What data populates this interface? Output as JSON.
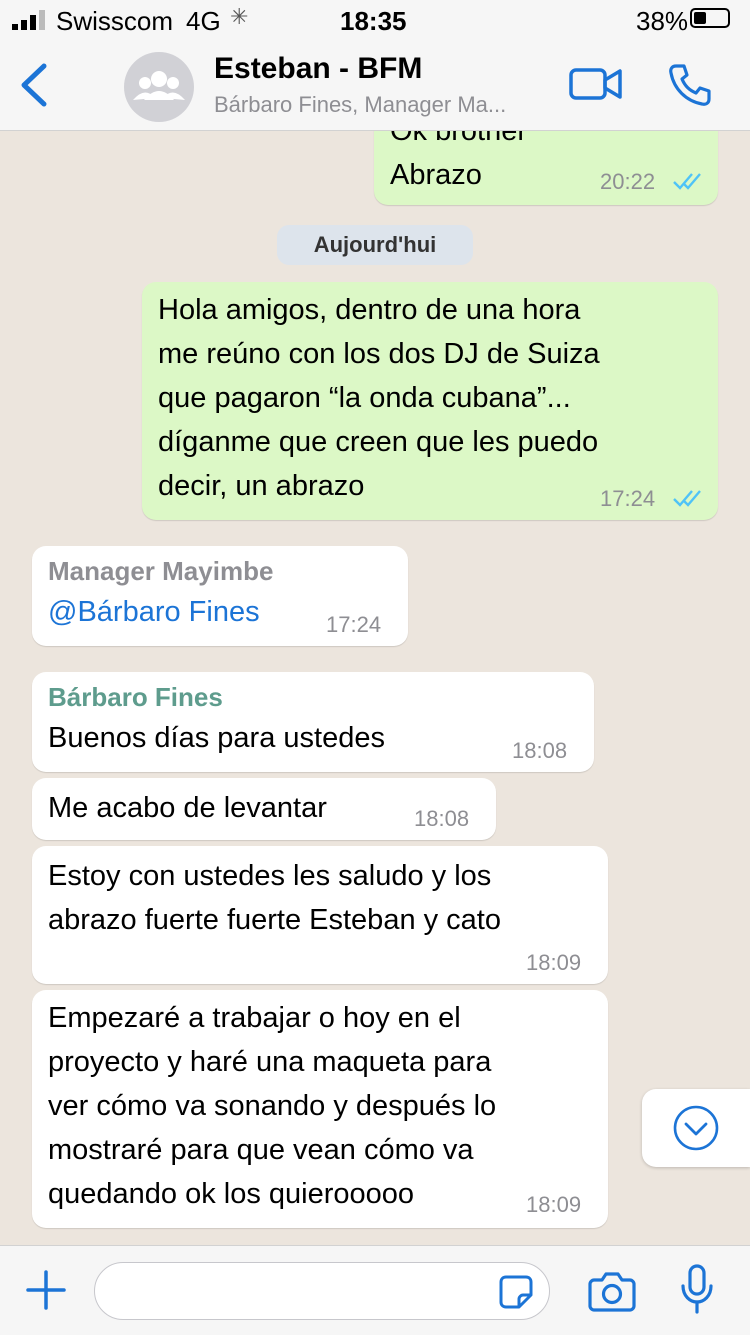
{
  "status_bar": {
    "carrier": "Swisscom",
    "network": "4G",
    "time": "18:35",
    "battery": "38%"
  },
  "header": {
    "title": "Esteban - BFM",
    "subtitle": "Bárbaro Fines, Manager Ma..."
  },
  "date_divider": "Aujourd'hui",
  "messages": [
    {
      "type": "outgoing",
      "text": "Ok brother\nAbrazo",
      "time": "20:22",
      "read": true
    },
    {
      "type": "outgoing",
      "text": "Hola amigos, dentro de una hora\nme reúno con los dos DJ de Suiza\nque pagaron “la onda cubana”...\ndíganme que creen que les puedo\ndecir, un abrazo",
      "time": "17:24",
      "read": true
    },
    {
      "type": "incoming",
      "sender": "Manager Mayimbe",
      "sender_color": "#8e8e93",
      "text": "@Bárbaro Fines",
      "time": "17:24"
    },
    {
      "type": "incoming",
      "sender": "Bárbaro Fines",
      "sender_color": "#5e9c8d",
      "text": "Buenos días para ustedes",
      "time": "18:08"
    },
    {
      "type": "incoming",
      "text": "Me acabo de levantar",
      "time": "18:08"
    },
    {
      "type": "incoming",
      "text": "Estoy con ustedes les saludo y los\nabrazo fuerte fuerte Esteban y cato",
      "time": "18:09"
    },
    {
      "type": "incoming",
      "text": "Empezaré a trabajar o hoy en el\nproyecto y haré una maqueta para\nver cómo va sonando y después lo\nmostraré para que vean cómo va\nquedando ok los quierooooo",
      "time": "18:09"
    }
  ],
  "input": {
    "value": "",
    "placeholder": ""
  },
  "icons": {
    "back": "chevron-left-icon",
    "avatar": "group-avatar-icon",
    "video": "video-camera-icon",
    "call": "phone-icon",
    "scroll": "chevron-down-circle-icon",
    "plus": "plus-icon",
    "sticker": "sticker-icon",
    "camera": "camera-icon",
    "mic": "microphone-icon",
    "read": "double-check-icon"
  },
  "colors": {
    "accent": "#1c74d6",
    "outgoing_bubble": "#dcf8c6",
    "incoming_bubble": "#ffffff",
    "read_ticks": "#4fc3f7"
  }
}
